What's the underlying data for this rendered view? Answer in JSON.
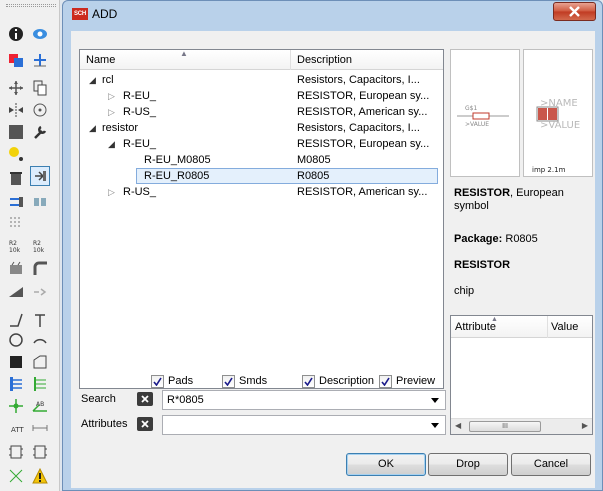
{
  "window": {
    "icon_text": "SCH",
    "title": "ADD"
  },
  "tree": {
    "columns": {
      "name": "Name",
      "description": "Description"
    },
    "rows": [
      {
        "name": "rcl",
        "description": "Resistors, Capacitors, I..."
      },
      {
        "name": "R-EU_",
        "description": "RESISTOR, European sy..."
      },
      {
        "name": "R-US_",
        "description": "RESISTOR, American sy..."
      },
      {
        "name": "resistor",
        "description": "Resistors, Capacitors, I..."
      },
      {
        "name": "R-EU_",
        "description": "RESISTOR, European sy..."
      },
      {
        "name": "R-EU_M0805",
        "description": "M0805"
      },
      {
        "name": "R-EU_R0805",
        "description": "R0805"
      },
      {
        "name": "R-US_",
        "description": "RESISTOR, American sy..."
      }
    ],
    "selected_row": 6
  },
  "preview": {
    "symbol": {
      "name_text": ">NAME",
      "value_text": ">VALUE",
      "gate": "G$1",
      "value_small": ">VALUE"
    },
    "package": {
      "label": "imp\n2.1m"
    }
  },
  "info": {
    "title_bold": "RESISTOR",
    "title_rest": ", European symbol",
    "package_label": "Package:",
    "package_value": "R0805",
    "heading": "RESISTOR",
    "description": "chip"
  },
  "attributes_table": {
    "columns": {
      "attribute": "Attribute",
      "value": "Value"
    },
    "scroll_thumb": "III"
  },
  "options": {
    "pads": "Pads",
    "smds": "Smds",
    "description": "Description",
    "preview": "Preview"
  },
  "search": {
    "label": "Search",
    "value": "R*0805"
  },
  "attributes": {
    "label": "Attributes",
    "value": ""
  },
  "buttons": {
    "ok": "OK",
    "drop": "Drop",
    "cancel": "Cancel"
  },
  "colors": {
    "title_bg": "#b9d1ea",
    "selection": "#e4f0fc",
    "close": "#c13b22",
    "symbol_red": "#c0392b"
  }
}
